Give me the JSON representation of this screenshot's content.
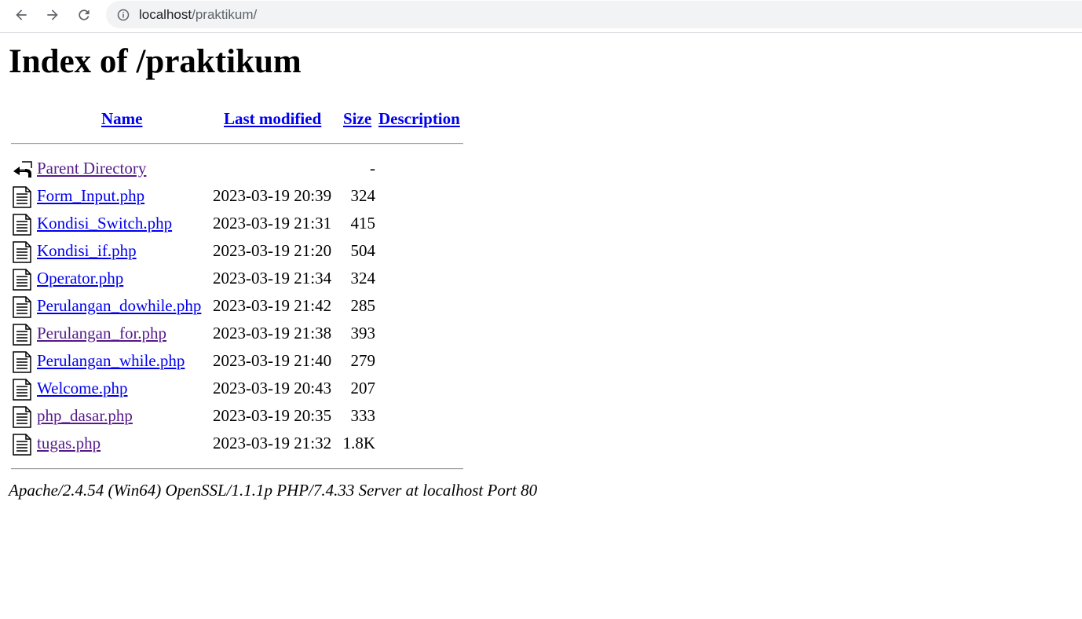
{
  "browser": {
    "url_host": "localhost",
    "url_path": "/praktikum/",
    "icons": {
      "back": "arrow-left-icon",
      "forward": "arrow-right-icon",
      "reload": "reload-icon",
      "info": "info-icon"
    }
  },
  "page_title": "Index of /praktikum",
  "columns": {
    "name": "Name",
    "last_modified": "Last modified",
    "size": "Size",
    "description": "Description"
  },
  "entries": [
    {
      "name": "Parent Directory",
      "modified": "",
      "size": "-",
      "icon": "back-folder-icon",
      "visited": true
    },
    {
      "name": "Form_Input.php",
      "modified": "2023-03-19 20:39",
      "size": "324",
      "icon": "file-icon",
      "visited": false
    },
    {
      "name": "Kondisi_Switch.php",
      "modified": "2023-03-19 21:31",
      "size": "415",
      "icon": "file-icon",
      "visited": false
    },
    {
      "name": "Kondisi_if.php",
      "modified": "2023-03-19 21:20",
      "size": "504",
      "icon": "file-icon",
      "visited": false
    },
    {
      "name": "Operator.php",
      "modified": "2023-03-19 21:34",
      "size": "324",
      "icon": "file-icon",
      "visited": false
    },
    {
      "name": "Perulangan_dowhile.php",
      "modified": "2023-03-19 21:42",
      "size": "285",
      "icon": "file-icon",
      "visited": false
    },
    {
      "name": "Perulangan_for.php",
      "modified": "2023-03-19 21:38",
      "size": "393",
      "icon": "file-icon",
      "visited": true
    },
    {
      "name": "Perulangan_while.php",
      "modified": "2023-03-19 21:40",
      "size": "279",
      "icon": "file-icon",
      "visited": false
    },
    {
      "name": "Welcome.php",
      "modified": "2023-03-19 20:43",
      "size": "207",
      "icon": "file-icon",
      "visited": false
    },
    {
      "name": "php_dasar.php",
      "modified": "2023-03-19 20:35",
      "size": "333",
      "icon": "file-icon",
      "visited": true
    },
    {
      "name": "tugas.php",
      "modified": "2023-03-19 21:32",
      "size": "1.8K",
      "icon": "file-icon",
      "visited": true
    }
  ],
  "footer": "Apache/2.4.54 (Win64) OpenSSL/1.1.1p PHP/7.4.33 Server at localhost Port 80",
  "colors": {
    "link": "#0000ee",
    "visited_link": "#551a8b",
    "omnibox_bg": "#f1f3f4"
  }
}
